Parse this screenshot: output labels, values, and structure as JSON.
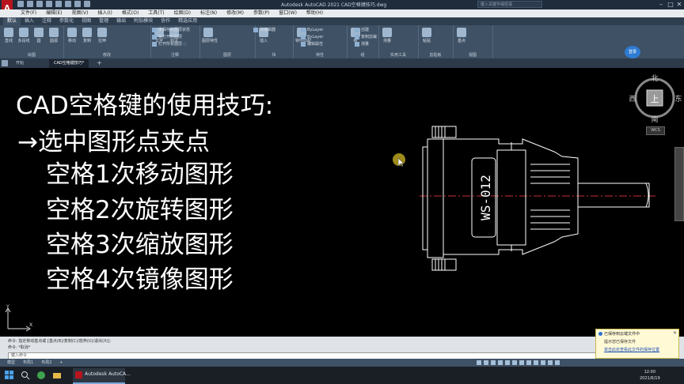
{
  "window": {
    "title": "Autodesk AutoCAD 2021   CAD空格键技巧.dwg",
    "search_placeholder": "键入关键字或短语",
    "logo": "A"
  },
  "menubar": [
    "文件(F)",
    "编辑(E)",
    "视图(V)",
    "插入(I)",
    "格式(O)",
    "工具(T)",
    "绘图(D)",
    "标注(N)",
    "修改(M)",
    "参数(P)",
    "窗口(W)",
    "帮助(H)"
  ],
  "ribbon_tabs": [
    {
      "label": "默认",
      "active": true
    },
    {
      "label": "插入"
    },
    {
      "label": "注释"
    },
    {
      "label": "参数化"
    },
    {
      "label": "视图"
    },
    {
      "label": "管理"
    },
    {
      "label": "输出"
    },
    {
      "label": "附加模块"
    },
    {
      "label": "协作"
    },
    {
      "label": "精选应用"
    }
  ],
  "ribbon": {
    "groups": [
      {
        "label": "绘图",
        "buttons": [
          "直线",
          "多段线",
          "圆",
          "圆弧"
        ]
      },
      {
        "label": "修改",
        "buttons": [
          "移动",
          "复制",
          "拉伸"
        ]
      },
      {
        "label": "注释",
        "buttons": [
          "文字",
          "标注"
        ]
      },
      {
        "label": "图层",
        "buttons": [
          "图层特性"
        ]
      },
      {
        "label": "块",
        "buttons": [
          "插入"
        ]
      },
      {
        "label": "特性",
        "buttons": [
          "特性匹配"
        ]
      },
      {
        "label": "组",
        "buttons": [
          "组"
        ]
      },
      {
        "label": "实用工具",
        "buttons": [
          "测量"
        ]
      },
      {
        "label": "剪贴板",
        "buttons": [
          "粘贴"
        ]
      },
      {
        "label": "视图",
        "buttons": [
          "基点"
        ]
      }
    ],
    "small_rows": [
      "未保存的图层状态",
      "仅打开的图层",
      "打开所有图层 ◌",
      "块编辑器",
      "ByLayer",
      "ByLayer",
      "编辑属性",
      "创建",
      "复制剪裁",
      "测量"
    ],
    "signin": "登录"
  },
  "doc_tabs": [
    {
      "label": "开始"
    },
    {
      "label": "CAD空格键技巧*",
      "active": true
    }
  ],
  "canvas_text": {
    "heading": "CAD空格键的使用技巧:",
    "arrow_line": "→选中图形点夹点",
    "items": [
      "空格1次移动图形",
      "空格2次旋转图形",
      "空格3次缩放图形",
      "空格4次镜像图形"
    ]
  },
  "drawing": {
    "label": "WS-012"
  },
  "viewcube": {
    "north": "北",
    "south": "南",
    "east": "东",
    "west": "西",
    "top": "上",
    "wcs": "WCS"
  },
  "ucs": {
    "x": "X",
    "y": "Y"
  },
  "command_line": {
    "history": [
      "命令: 指定移动基点或 [基点(B)/复制(C)/放弃(U)/退出(X)]:",
      "命令: *取消*"
    ],
    "input_placeholder": "键入命令"
  },
  "status_bar": {
    "tabs": [
      "模型",
      "布局1",
      "布局2",
      "+"
    ]
  },
  "notification": {
    "title": "已保存到云端文件中",
    "line2": "提示您已保存文件",
    "link": "单击此处查看此文件的保存位置"
  },
  "taskbar": {
    "app_label": "Autodesk AutoCA...",
    "time": "12:00",
    "date": "2021/6/19"
  },
  "colors": {
    "titlebar": "#1f2c3c",
    "ribbon": "#3e5165",
    "canvas": "#000000",
    "autocad_red": "#b8141d"
  }
}
